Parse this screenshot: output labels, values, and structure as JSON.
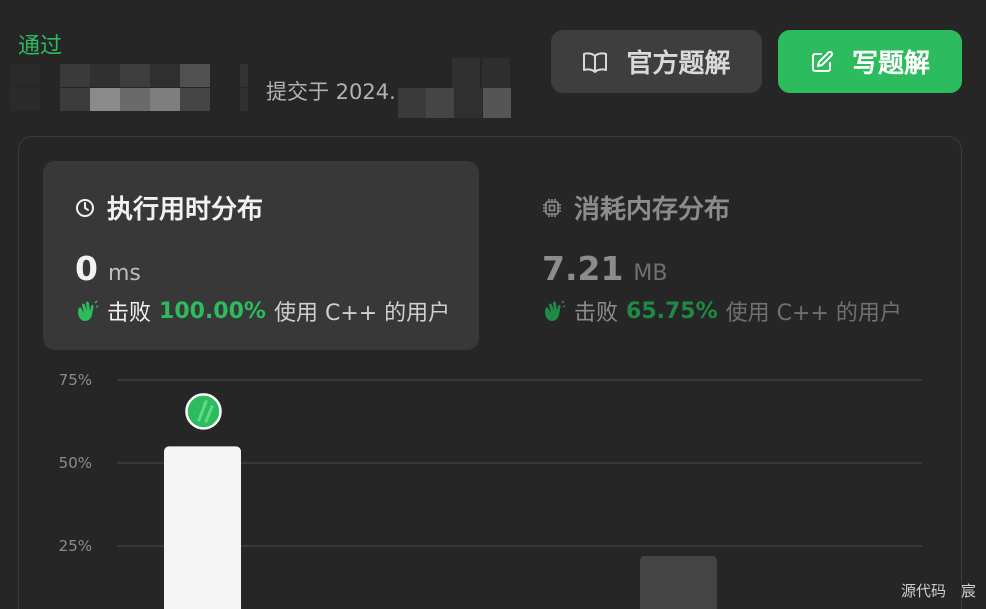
{
  "header": {
    "status": "通过",
    "submitted_prefix": "提交于 2024.",
    "official_solution_label": "官方题解",
    "write_solution_label": "写题解"
  },
  "runtime": {
    "title": "执行用时分布",
    "value": "0",
    "unit": "ms",
    "beats_label": "击败",
    "beats_pct": "100.00%",
    "beats_suffix": "使用 C++ 的用户"
  },
  "memory": {
    "title": "消耗内存分布",
    "value": "7.21",
    "unit": "MB",
    "beats_label": "击败",
    "beats_pct": "65.75%",
    "beats_suffix": "使用 C++ 的用户"
  },
  "chart_data": {
    "type": "bar",
    "y_ticks": [
      "75%",
      "50%",
      "25%"
    ],
    "ylim": [
      0,
      80
    ],
    "grid": true,
    "bars": [
      {
        "value": 55,
        "highlight": true
      },
      {
        "value": 22,
        "highlight": false
      }
    ]
  },
  "watermark": "源代码　宸",
  "colors": {
    "accent": "#2cbb5d",
    "background": "#262626",
    "card": "#383838"
  }
}
